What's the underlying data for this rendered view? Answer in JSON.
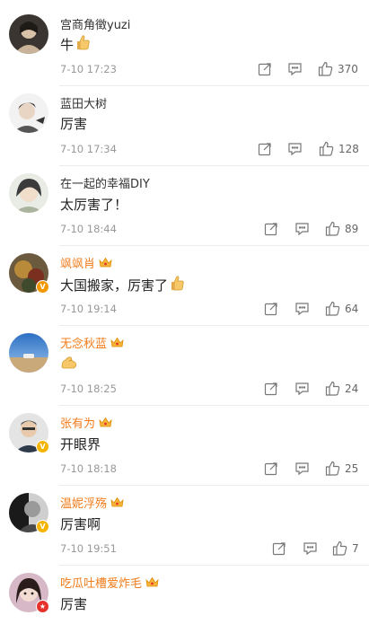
{
  "colors": {
    "vip_name": "#f07c1b",
    "name": "#333333",
    "time": "#999999"
  },
  "comments": [
    {
      "name": "宫商角徵yuzi",
      "text": "牛",
      "time": "7-10 17:23",
      "likes": "370",
      "vip": false,
      "emoji": "thumbs-up"
    },
    {
      "name": "蓝田大树",
      "text": "厉害",
      "time": "7-10 17:34",
      "likes": "128",
      "vip": false
    },
    {
      "name": "在一起的幸福DIY",
      "text": "太厉害了！",
      "time": "7-10 18:44",
      "likes": "89",
      "vip": false
    },
    {
      "name": "飒飒肖",
      "text": "大国搬家，厉害了",
      "time": "7-10 19:14",
      "likes": "64",
      "vip": true,
      "badge": "V",
      "emoji": "thumbs-up"
    },
    {
      "name": "无念秋蓝",
      "text": "",
      "time": "7-10 18:25",
      "likes": "24",
      "vip": true,
      "emoji": "flexed-biceps"
    },
    {
      "name": "张有为",
      "text": "开眼界",
      "time": "7-10 18:18",
      "likes": "25",
      "vip": true,
      "badge": "V"
    },
    {
      "name": "温妮浮殇",
      "text": "厉害啊",
      "time": "7-10 19:51",
      "likes": "7",
      "vip": true,
      "badge": "V"
    },
    {
      "name": "吃瓜吐槽爱炸毛",
      "text": "厉害",
      "vip": true,
      "badge": "★"
    }
  ]
}
